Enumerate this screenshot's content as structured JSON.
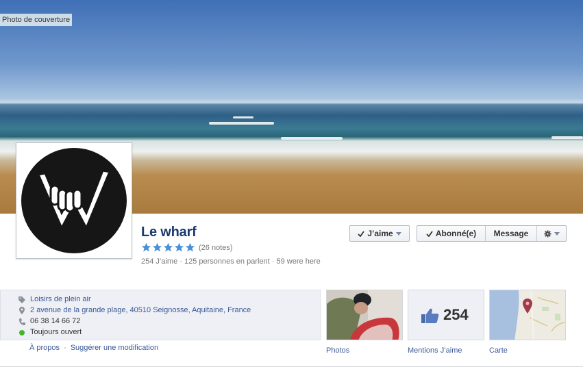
{
  "cover": {
    "label": "Photo de couverture"
  },
  "page": {
    "name": "Le wharf",
    "rating_stars": 5,
    "rating_count": "(26 notes)",
    "stats": "254 J’aime · 125 personnes en parlent · 59 were here"
  },
  "actions": {
    "like": "J’aime",
    "follow": "Abonné(e)",
    "message": "Message"
  },
  "info": {
    "category": "Loisirs de plein air",
    "address": "2 avenue de la grande plage, 40510 Seignosse, Aquitaine, France",
    "phone": "06 38 14 66 72",
    "hours": "Toujours ouvert",
    "about_link": "À propos",
    "separator": "-",
    "suggest_link": "Suggérer une modification"
  },
  "apps": {
    "photos_label": "Photos",
    "likes_count": "254",
    "likes_label": "Mentions J’aime",
    "map_label": "Carte"
  },
  "colors": {
    "link": "#3b5998",
    "name": "#1b3a6f",
    "star": "#4a90d9",
    "open_status": "#42b72a"
  },
  "icons": [
    "tag-icon",
    "map-pin-icon",
    "phone-icon",
    "status-dot-icon",
    "checkmark-icon",
    "gear-icon",
    "caret-down-icon",
    "thumbs-up-icon",
    "map-marker-icon",
    "star-icon"
  ]
}
